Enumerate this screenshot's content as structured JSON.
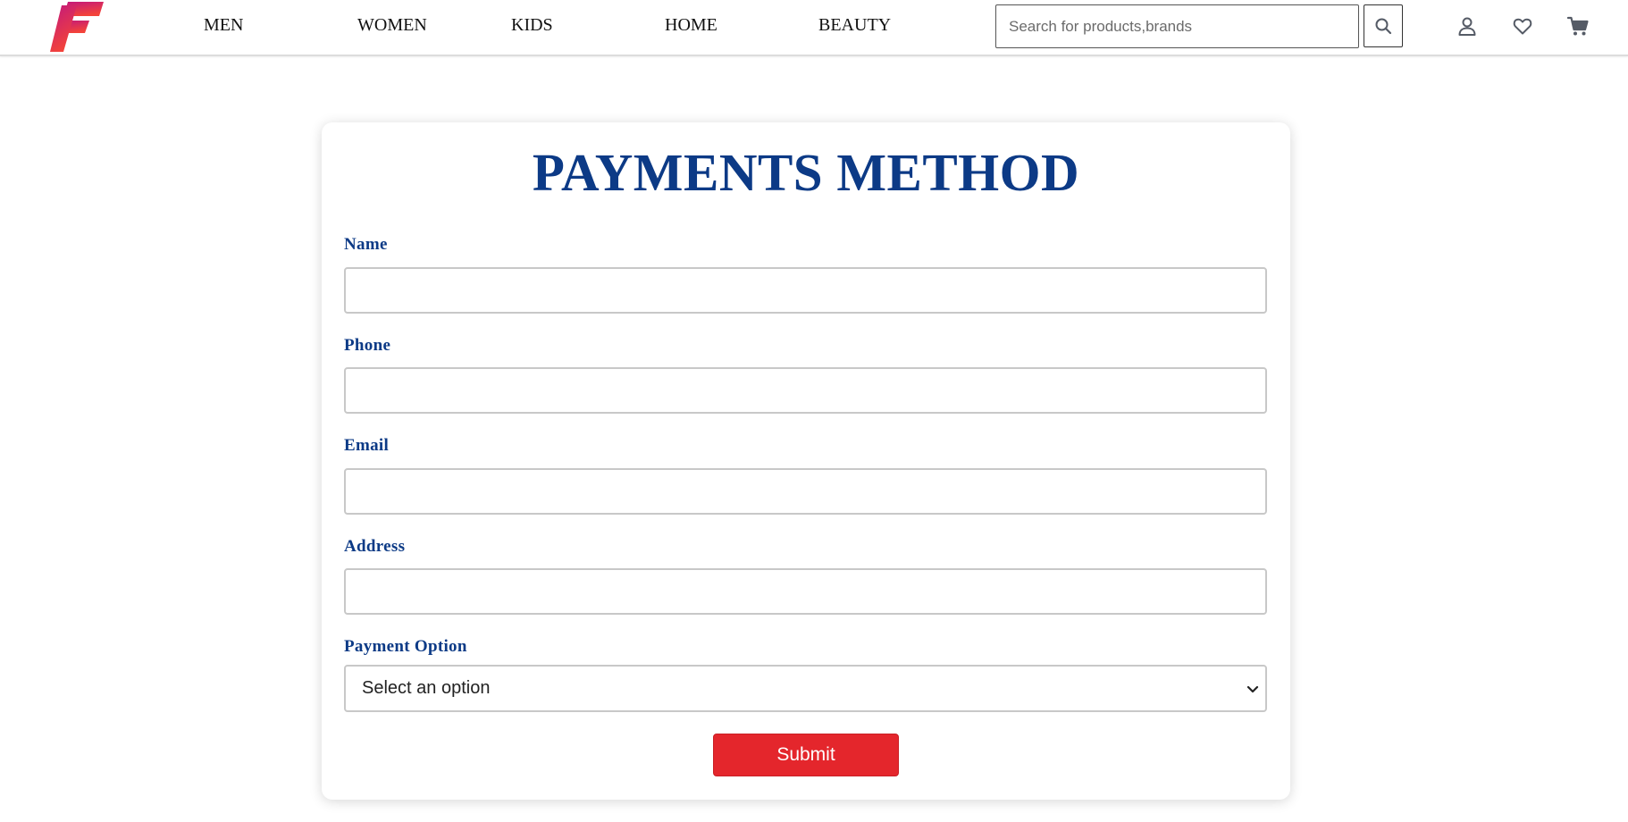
{
  "header": {
    "logo_name": "brand-logo",
    "nav": [
      "MEN",
      "WOMEN",
      "KIDS",
      "HOME",
      "BEAUTY"
    ],
    "search": {
      "placeholder": "Search for products,brands",
      "value": ""
    },
    "icons": [
      "search-icon",
      "user-icon",
      "heart-icon",
      "cart-icon"
    ]
  },
  "form": {
    "title": "PAYMENTS METHOD",
    "fields": [
      {
        "label": "Name",
        "value": ""
      },
      {
        "label": "Phone",
        "value": ""
      },
      {
        "label": "Email",
        "value": ""
      },
      {
        "label": "Address",
        "value": ""
      }
    ],
    "payment": {
      "label": "Payment Option",
      "selected": "Select an option"
    },
    "submit_label": "Submit"
  },
  "colors": {
    "title": "#0c3a86",
    "submit": "#e4262c",
    "logo_gradient": [
      "#c2187c",
      "#f3433a"
    ]
  }
}
